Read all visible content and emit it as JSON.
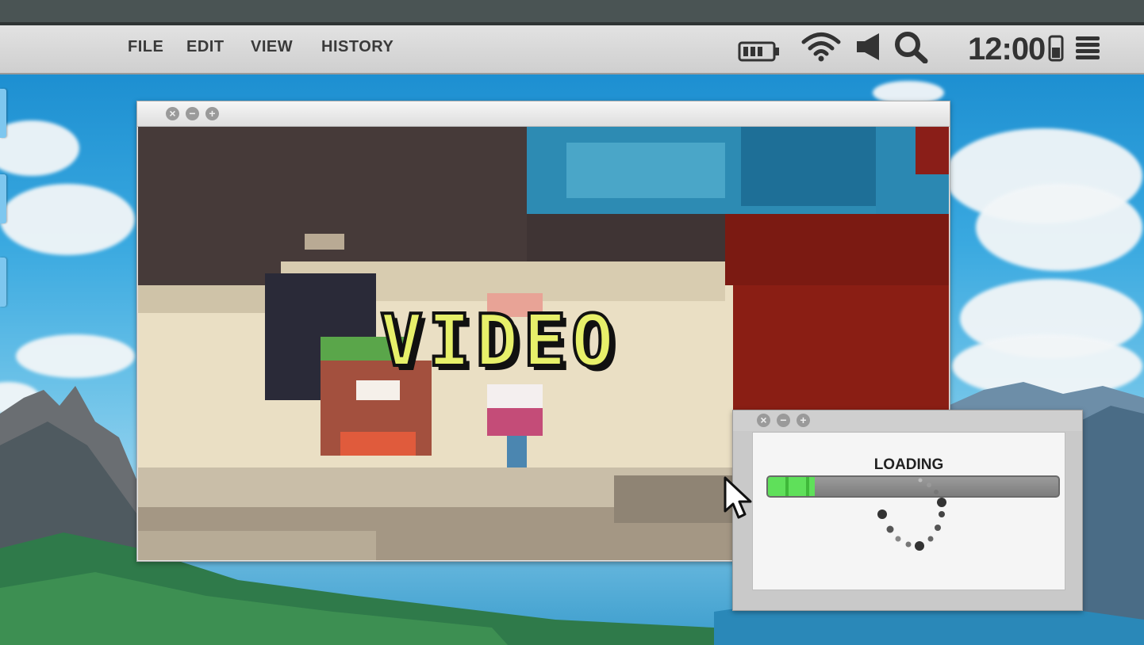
{
  "menubar": {
    "items": [
      {
        "label": "FILE"
      },
      {
        "label": "EDIT"
      },
      {
        "label": "VIEW"
      },
      {
        "label": "HISTORY"
      }
    ],
    "clock": "12:00",
    "icons": [
      "battery-icon",
      "wifi-icon",
      "volume-icon",
      "search-icon",
      "phone-icon",
      "menu-icon"
    ]
  },
  "video_window": {
    "controls": [
      "close",
      "minimize",
      "maximize"
    ],
    "overlay_text": "VIDEO"
  },
  "loading_window": {
    "controls": [
      "close",
      "minimize",
      "maximize"
    ],
    "title": "LOADING",
    "progress_percent": 16,
    "accent_color": "#5fe05a"
  }
}
